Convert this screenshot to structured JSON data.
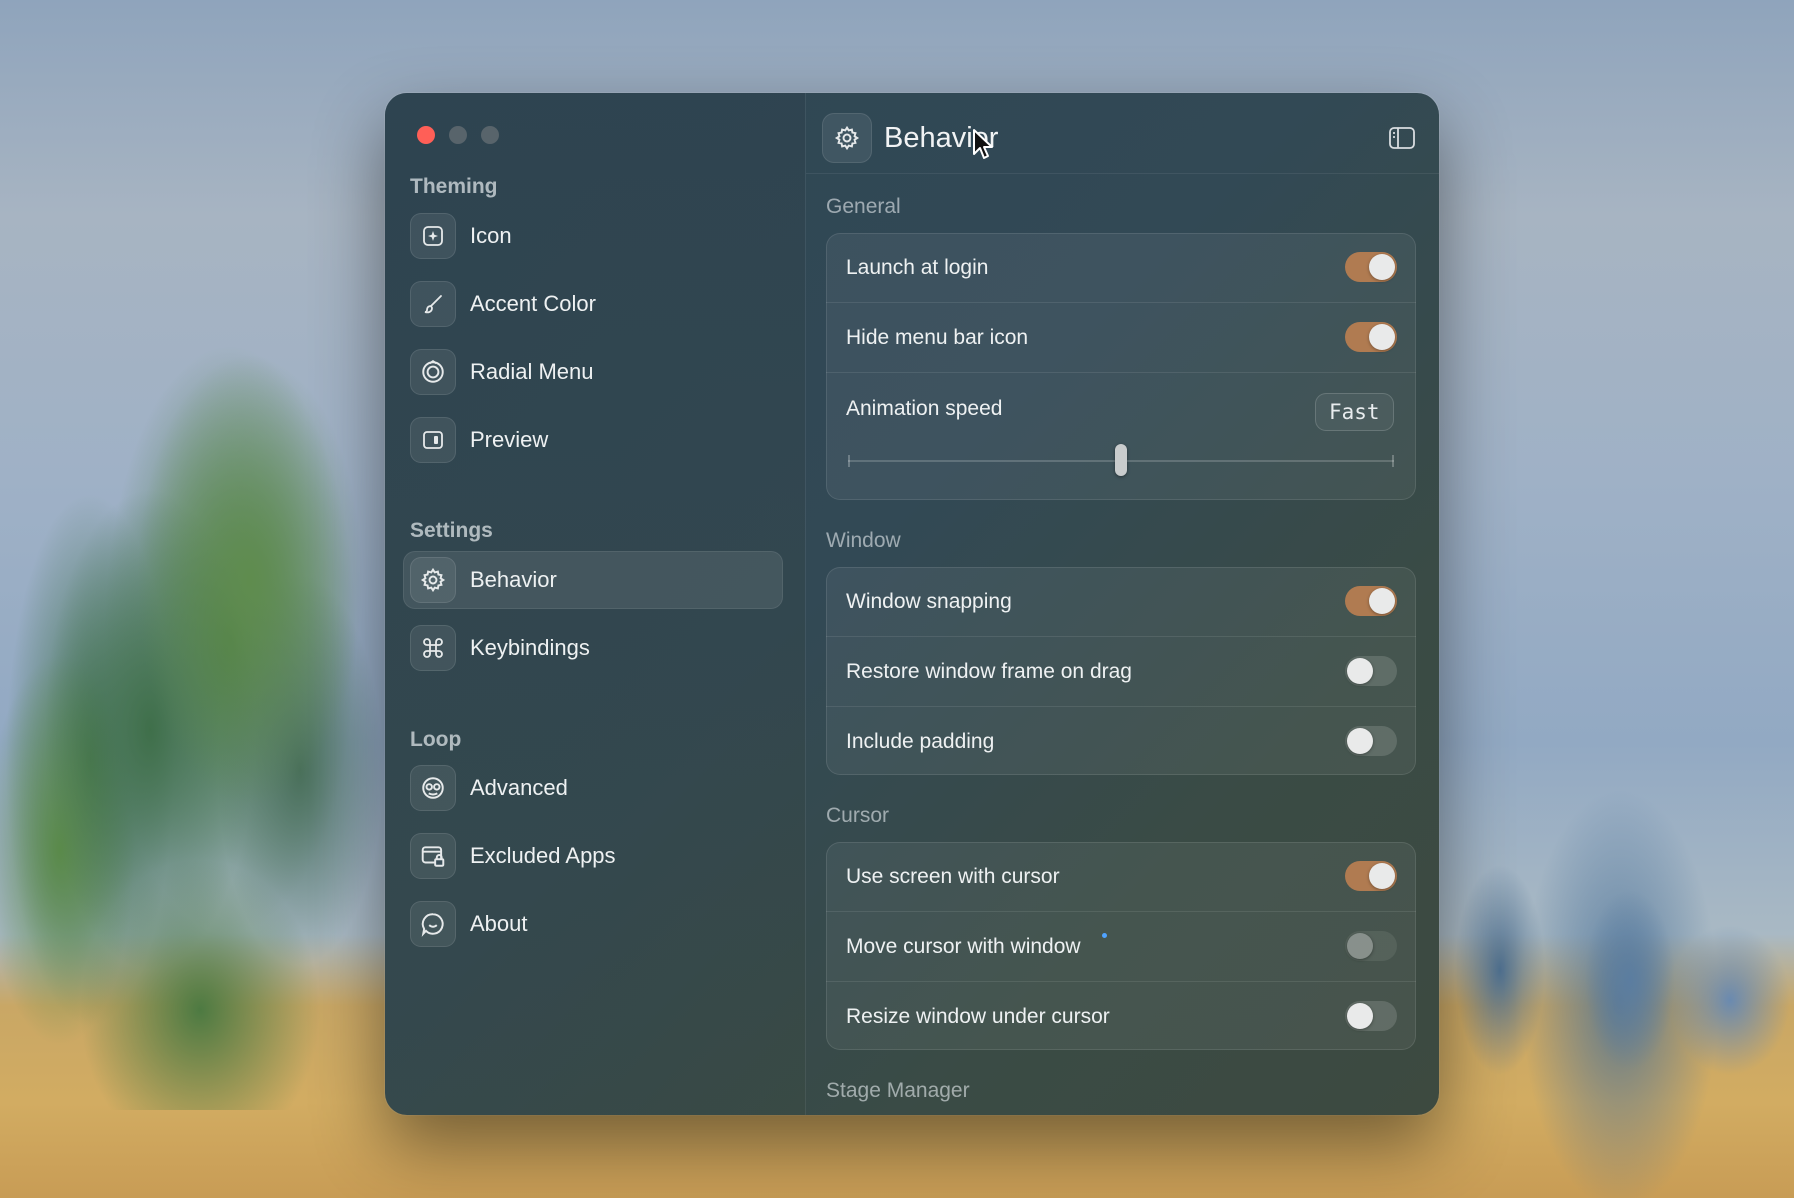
{
  "window": {
    "title": "Behavior",
    "title_icon": "gear-icon",
    "toggle_sidebar_icon": "sidebar-toggle-icon"
  },
  "sidebar": {
    "sections": [
      {
        "label": "Theming",
        "items": [
          {
            "label": "Icon",
            "icon": "app-icon"
          },
          {
            "label": "Accent Color",
            "icon": "paintbrush-icon"
          },
          {
            "label": "Radial Menu",
            "icon": "radial-ring-icon"
          },
          {
            "label": "Preview",
            "icon": "preview-panel-icon"
          }
        ]
      },
      {
        "label": "Settings",
        "items": [
          {
            "label": "Behavior",
            "icon": "gear-icon",
            "selected": true
          },
          {
            "label": "Keybindings",
            "icon": "command-icon"
          }
        ]
      },
      {
        "label": "Loop",
        "items": [
          {
            "label": "Advanced",
            "icon": "gauge-icon"
          },
          {
            "label": "Excluded Apps",
            "icon": "window-lock-icon"
          },
          {
            "label": "About",
            "icon": "message-bubble-icon"
          }
        ]
      }
    ]
  },
  "main": {
    "groups": [
      {
        "label": "General",
        "rows": [
          {
            "label": "Launch at login",
            "toggle": true
          },
          {
            "label": "Hide menu bar icon",
            "toggle": true
          },
          {
            "label": "Animation speed",
            "value": "Fast",
            "slider_position": 0.5
          }
        ]
      },
      {
        "label": "Window",
        "rows": [
          {
            "label": "Window snapping",
            "toggle": true
          },
          {
            "label": "Restore window frame on drag",
            "toggle": false
          },
          {
            "label": "Include padding",
            "toggle": false
          }
        ]
      },
      {
        "label": "Cursor",
        "rows": [
          {
            "label": "Use screen with cursor",
            "toggle": true
          },
          {
            "label": "Move cursor with window",
            "toggle": false,
            "disabled": true
          },
          {
            "label": "Resize window under cursor",
            "toggle": false
          }
        ]
      },
      {
        "label": "Stage Manager",
        "rows": []
      }
    ]
  },
  "colors": {
    "accent_toggle": "#b07b51",
    "close_button": "#ff5f57"
  }
}
